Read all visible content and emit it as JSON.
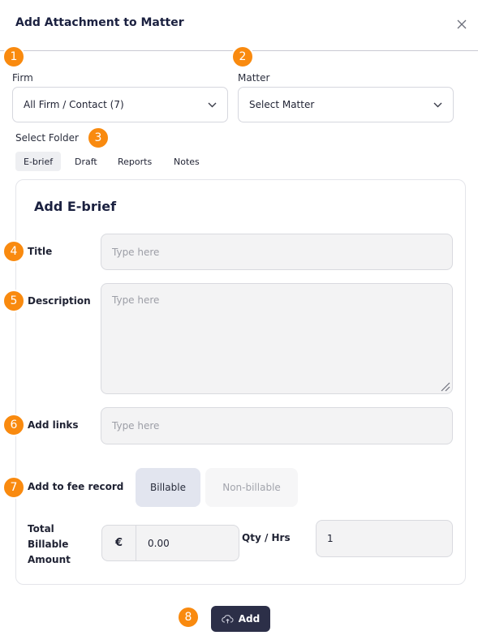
{
  "dialog": {
    "title": "Add Attachment to Matter"
  },
  "firm": {
    "label": "Firm",
    "value": "All Firm / Contact (7)"
  },
  "matter": {
    "label": "Matter",
    "value": "Select Matter"
  },
  "folder": {
    "label": "Select Folder",
    "tabs": [
      "E-brief",
      "Draft",
      "Reports",
      "Notes"
    ],
    "active_tab": "E-brief"
  },
  "form": {
    "heading": "Add E-brief",
    "title_label": "Title",
    "title_placeholder": "Type here",
    "description_label": "Description",
    "description_placeholder": "Type here",
    "links_label": "Add links",
    "links_placeholder": "Type here",
    "fee_label": "Add to fee record",
    "billable_label": "Billable",
    "nonbillable_label": "Non-billable",
    "total_label_line1": "Total",
    "total_label_line2": "Billable",
    "total_label_line3": "Amount",
    "currency_symbol": "€",
    "amount_value": "0.00",
    "qty_label": "Qty / Hrs",
    "qty_value": "1"
  },
  "submit": {
    "label": "Add"
  },
  "badges": [
    "1",
    "2",
    "3",
    "4",
    "5",
    "6",
    "7",
    "8"
  ],
  "colors": {
    "badge": "#f98a0f",
    "primary_button": "#2c2f48",
    "active_toggle": "#e2e5ef"
  },
  "icons": {
    "close": "close-icon",
    "chevron": "chevron-down-icon",
    "upload": "cloud-upload-icon"
  }
}
